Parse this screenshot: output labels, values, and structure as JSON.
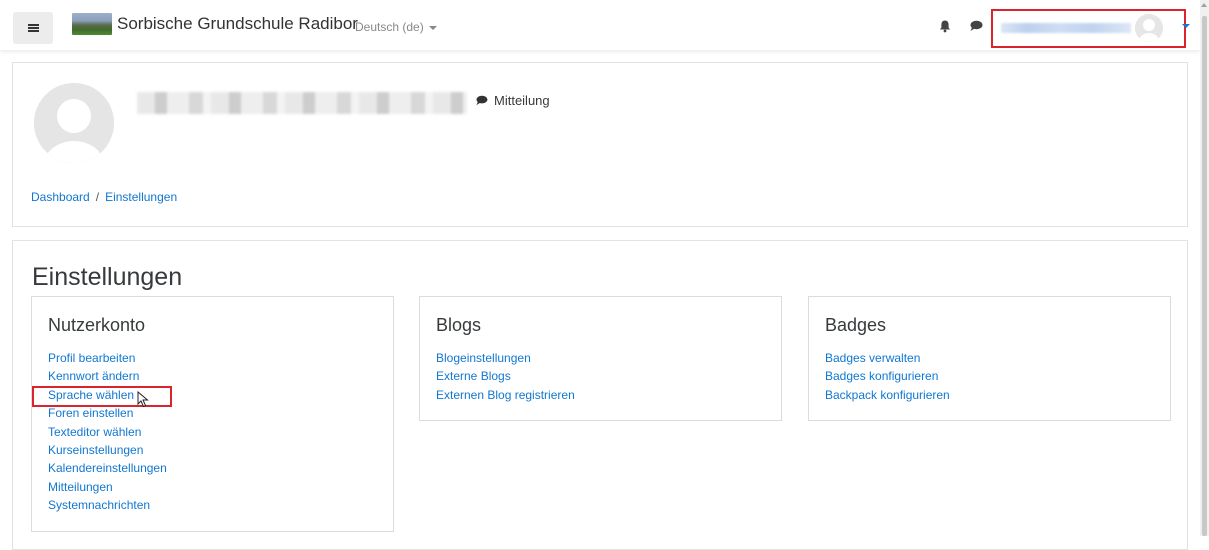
{
  "navbar": {
    "site_name": "Sorbische Grundschule Radibor",
    "language": "Deutsch (de)"
  },
  "header": {
    "message_label": "Mitteilung",
    "breadcrumb": [
      "Dashboard",
      "Einstellungen"
    ],
    "breadcrumb_separator": "/"
  },
  "main": {
    "title": "Einstellungen",
    "panels": [
      {
        "title": "Nutzerkonto",
        "links": [
          "Profil bearbeiten",
          "Kennwort ändern",
          "Sprache wählen",
          "Foren einstellen",
          "Texteditor wählen",
          "Kurseinstellungen",
          "Kalendereinstellungen",
          "Mitteilungen",
          "Systemnachrichten"
        ]
      },
      {
        "title": "Blogs",
        "links": [
          "Blogeinstellungen",
          "Externe Blogs",
          "Externen Blog registrieren"
        ]
      },
      {
        "title": "Badges",
        "links": [
          "Badges verwalten",
          "Badges konfigurieren",
          "Backpack konfigurieren"
        ]
      }
    ]
  },
  "colors": {
    "link": "#1177d1",
    "highlight": "#d9232d"
  }
}
